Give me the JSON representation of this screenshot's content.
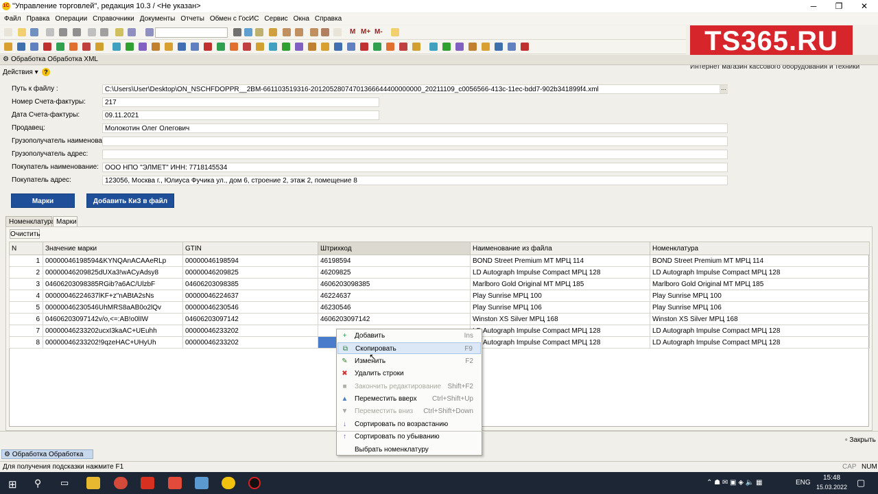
{
  "window": {
    "title": "\"Управление торговлей\", редакция 10.3 / <Не указан>",
    "min_glyph": "─",
    "max_glyph": "❐",
    "close_glyph": "✕"
  },
  "menu": [
    "Файл",
    "Правка",
    "Операции",
    "Справочники",
    "Документы",
    "Отчеты",
    "Обмен с ГосИС",
    "Сервис",
    "Окна",
    "Справка"
  ],
  "toolbar": {
    "menu_m": "M",
    "menu_mplus": "M+",
    "menu_mminus": "M-"
  },
  "brand": {
    "logo": "TS365.RU",
    "tagline": "Интернет магазин кассового оборудования и техники"
  },
  "form": {
    "title": "Обработка  Обработка XML",
    "actions_label": "Действия",
    "fields": [
      {
        "label": "Путь к файлу :",
        "value": "C:\\Users\\User\\Desktop\\ON_NSCHFDOPPR__2BM-661103519316-20120528074701366644400000000_20211109_c0056566-413c-11ec-bdd7-902b341899f4.xml"
      },
      {
        "label": "Номер Счета-фактуры:",
        "value": "217"
      },
      {
        "label": "Дата Счета-фактуры:",
        "value": "09.11.2021"
      },
      {
        "label": "Продавец:",
        "value": "Молокотин Олег Олегович"
      },
      {
        "label": "Грузополучатель наименование:",
        "value": ""
      },
      {
        "label": "Грузополучатель адрес:",
        "value": ""
      },
      {
        "label": "Покупатель наименование:",
        "value": "ООО НПО \"ЭЛМЕТ\" ИНН: 7718145534"
      },
      {
        "label": "Покупатель адрес:",
        "value": "123056, Москва г., Юлиуса Фучика ул., дом 6, строение 2, этаж 2, помещение 8"
      }
    ],
    "buttons": {
      "marks": "Марки",
      "add_kiz": "Добавить КиЗ в файл"
    },
    "tabs": [
      "Номенклатура",
      "Марки"
    ],
    "clear_label": "Очистить"
  },
  "grid": {
    "columns": [
      "N",
      "Значение марки",
      "GTIN",
      "Штрихкод",
      "Наименование из файла",
      "Номенклатура"
    ],
    "rows": [
      [
        "1",
        "00000046198594&KYNQAnACAAeRLp",
        "00000046198594",
        "46198594",
        "BOND Street Premium MT МРЦ 114",
        "BOND Street Premium MT МРЦ 114"
      ],
      [
        "2",
        "00000046209825dUXa3!wACyAdsy8",
        "00000046209825",
        "46209825",
        "LD Autograph Impulse Compact МРЦ 128",
        "LD Autograph Impulse Compact МРЦ 128"
      ],
      [
        "3",
        "04606203098385RGib?a6AC/UlzbF",
        "04606203098385",
        "4606203098385",
        "Marlboro Gold Original MT МРЦ 185",
        "Marlboro Gold Original MT МРЦ 185"
      ],
      [
        "4",
        "00000046224637lKF+z\"nABtA2sNs",
        "00000046224637",
        "46224637",
        "Play Sunrise МРЦ 100",
        "Play Sunrise МРЦ 100"
      ],
      [
        "5",
        "00000046230546UhMRS8aAB0o2lQv",
        "00000046230546",
        "46230546",
        "Play Sunrise МРЦ 106",
        "Play Sunrise МРЦ 106"
      ],
      [
        "6",
        "04606203097142v/o,<=:AB!o0lIW",
        "04606203097142",
        "4606203097142",
        "Winston XS Silver МРЦ 168",
        "Winston XS Silver МРЦ 168"
      ],
      [
        "7",
        "00000046233202ucxI3kaAC+UEuhh",
        "00000046233202",
        "",
        "LD Autograph Impulse Compact МРЦ 128",
        "LD Autograph Impulse Compact МРЦ 128"
      ],
      [
        "8",
        "00000046233202!9qzeHAC+UHyUh",
        "00000046233202",
        "",
        "LD Autograph Impulse Compact МРЦ 128",
        "LD Autograph Impulse Compact МРЦ 128"
      ]
    ]
  },
  "context_menu": [
    {
      "label": "Добавить",
      "shortcut": "Ins",
      "icon": "add-icon",
      "glyph": "+",
      "disabled": false
    },
    {
      "label": "Скопировать",
      "shortcut": "F9",
      "icon": "copy-icon",
      "glyph": "⧉",
      "disabled": false
    },
    {
      "label": "Изменить",
      "shortcut": "F2",
      "icon": "edit-icon",
      "glyph": "✎",
      "disabled": false
    },
    {
      "label": "Удалить строки",
      "shortcut": "",
      "icon": "delete-icon",
      "glyph": "✖",
      "disabled": false
    },
    {
      "label": "Закончить редактирование",
      "shortcut": "Shift+F2",
      "icon": "finish-edit-icon",
      "glyph": "■",
      "disabled": true
    },
    {
      "label": "Переместить вверх",
      "shortcut": "Ctrl+Shift+Up",
      "icon": "move-up-icon",
      "glyph": "▲",
      "disabled": false
    },
    {
      "label": "Переместить вниз",
      "shortcut": "Ctrl+Shift+Down",
      "icon": "move-down-icon",
      "glyph": "▼",
      "disabled": true
    },
    {
      "label": "Сортировать по возрастанию",
      "shortcut": "",
      "icon": "sort-asc-icon",
      "glyph": "↓",
      "disabled": false
    },
    {
      "label": "Сортировать по убыванию",
      "shortcut": "",
      "icon": "sort-desc-icon",
      "glyph": "↑",
      "disabled": false
    },
    {
      "label": "Выбрать номенклатуру",
      "shortcut": "",
      "icon": "",
      "glyph": "",
      "disabled": false
    }
  ],
  "bottom": {
    "close_label": "Закрыть",
    "task_window": "Обработка  Обработка XML",
    "status_hint": "Для получения подсказки нажмите F1",
    "cap": "CAP",
    "num": "NUM"
  },
  "taskbar": {
    "lang": "ENG",
    "time": "15:48",
    "date": "15.03.2022"
  },
  "colors": {
    "accent_blue": "#1f4f99",
    "logo_red": "#d6262c",
    "taskbar": "#1c2634"
  }
}
